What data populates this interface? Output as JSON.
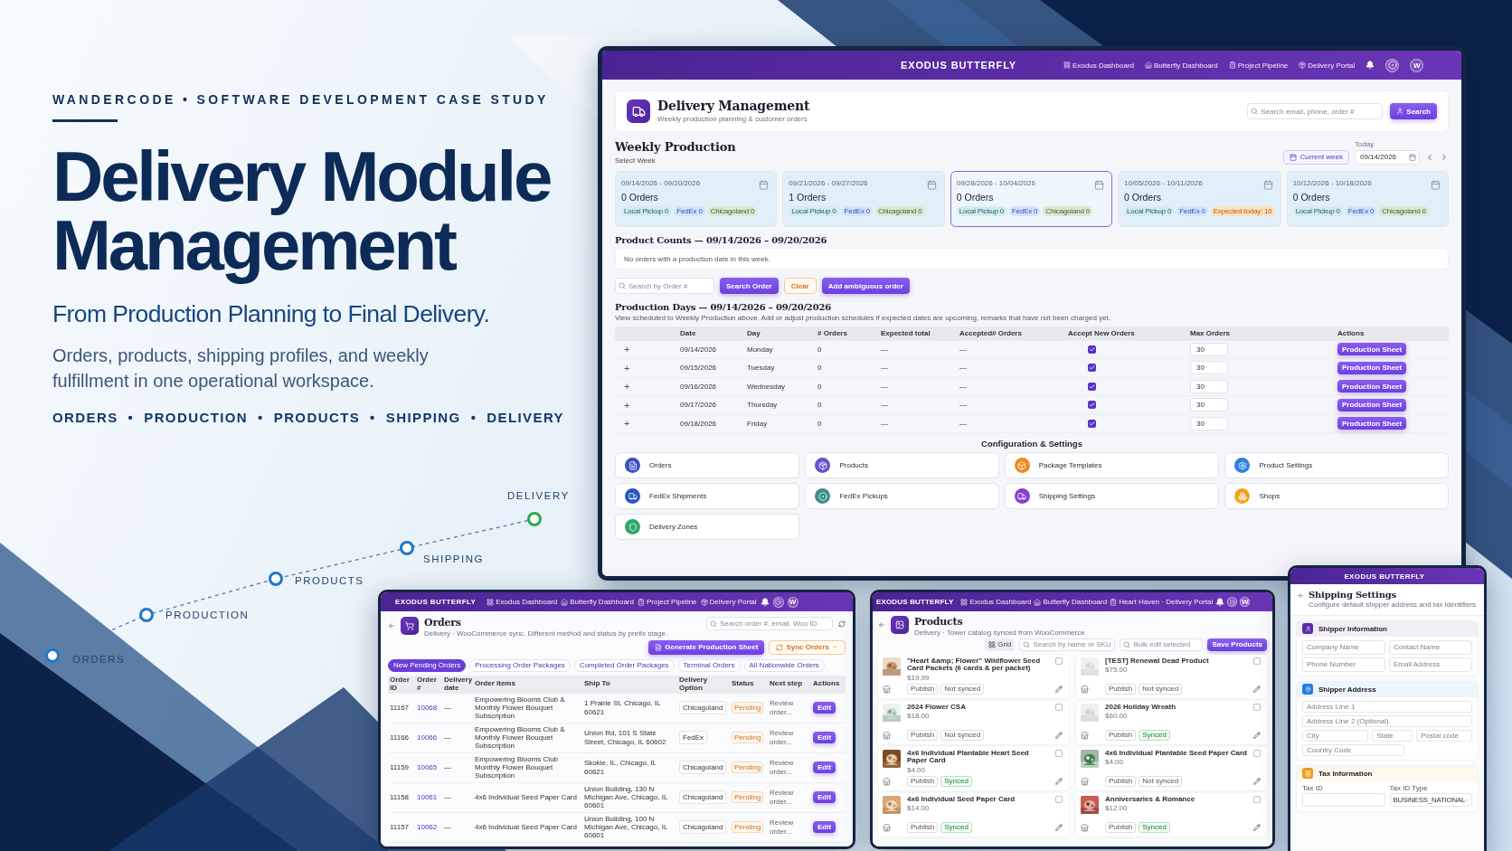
{
  "poster": {
    "kicker": "WANDERCODE • SOFTWARE DEVELOPMENT CASE STUDY",
    "headline_lines": [
      "Delivery Module",
      "Management"
    ],
    "subtitle": "From Production Planning to Final Delivery.",
    "description": "Orders, products, shipping profiles, and weekly fulfillment in one operational workspace.",
    "topic_separator": "•",
    "topics": [
      "ORDERS",
      "PRODUCTION",
      "PRODUCTS",
      "SHIPPING",
      "DELIVERY"
    ],
    "journey": [
      {
        "label": "ORDERS",
        "color": "#1f78c8"
      },
      {
        "label": "PRODUCTION",
        "color": "#1f78c8"
      },
      {
        "label": "PRODUCTS",
        "color": "#1f78c8"
      },
      {
        "label": "SHIPPING",
        "color": "#1f78c8"
      },
      {
        "label": "DELIVERY",
        "color": "#2ea84f"
      }
    ]
  },
  "main_app": {
    "bar": {
      "brand": "EXODUS BUTTERFLY",
      "nav": [
        "Exodus Dashboard",
        "Butterfly Dashboard",
        "Project Pipeline",
        "Delivery Portal"
      ],
      "avatar": "W"
    },
    "header": {
      "title": "Delivery Management",
      "subtitle": "Weekly production planning & customer orders",
      "search_placeholder": "Search email, phone, order #",
      "search_button": "Search"
    },
    "weekly": {
      "title": "Weekly Production",
      "hint": "Select Week",
      "current_week": "Current week",
      "today_label": "Today",
      "today_value": "09/14/2026",
      "weeks": [
        {
          "range": "09/14/2026 - 09/20/2026",
          "orders": "0 Orders",
          "selected": false,
          "chips": [
            {
              "label": "Local Pickup 0",
              "kind": "pickup"
            },
            {
              "label": "FedEx 0",
              "kind": "fedex"
            },
            {
              "label": "Chicagoland 0",
              "kind": "region"
            }
          ]
        },
        {
          "range": "09/21/2026 - 09/27/2026",
          "orders": "1 Orders",
          "selected": false,
          "chips": [
            {
              "label": "Local Pickup 0",
              "kind": "pickup"
            },
            {
              "label": "FedEx 0",
              "kind": "fedex"
            },
            {
              "label": "Chicagoland 0",
              "kind": "region"
            }
          ]
        },
        {
          "range": "09/28/2026 - 10/04/2026",
          "orders": "0 Orders",
          "selected": true,
          "chips": [
            {
              "label": "Local Pickup 0",
              "kind": "pickup"
            },
            {
              "label": "FedEx 0",
              "kind": "fedex"
            },
            {
              "label": "Chicagoland 0",
              "kind": "region"
            }
          ]
        },
        {
          "range": "10/05/2026 - 10/11/2026",
          "orders": "0 Orders",
          "selected": false,
          "chips": [
            {
              "label": "Local Pickup 0",
              "kind": "pickup"
            },
            {
              "label": "FedEx 0",
              "kind": "fedex"
            },
            {
              "label": "Expected today: 10",
              "kind": "alert"
            }
          ]
        },
        {
          "range": "10/12/2026 - 10/18/2026",
          "orders": "0 Orders",
          "selected": false,
          "chips": [
            {
              "label": "Local Pickup 0",
              "kind": "pickup"
            },
            {
              "label": "FedEx 0",
              "kind": "fedex"
            },
            {
              "label": "Chicagoland 0",
              "kind": "region"
            }
          ]
        }
      ]
    },
    "product_counts": {
      "title": "Product Counts — 09/14/2026 – 09/20/2026",
      "empty": "No orders with a production date in this week."
    },
    "order_search": {
      "placeholder": "Search by Order #",
      "search": "Search Order",
      "clear": "Clear",
      "add": "Add ambiguous order"
    },
    "production_days": {
      "title": "Production Days — 09/14/2026 – 09/20/2026",
      "note": "View scheduled to Weekly Production above. Add or adjust production schedules if expected dates are upcoming, remarks that have not been charged yet.",
      "columns": [
        "Date",
        "Day",
        "# Orders",
        "Expected total",
        "Accepted# Orders",
        "Accept New Orders",
        "Max Orders",
        "Actions"
      ],
      "rows": [
        {
          "expand": "+",
          "date": "09/14/2026",
          "day": "Monday",
          "orders": "0",
          "expected": "—",
          "accepted": "—",
          "accept_new": true,
          "max": "30",
          "action": "Production Sheet"
        },
        {
          "expand": "+",
          "date": "09/15/2026",
          "day": "Tuesday",
          "orders": "0",
          "expected": "—",
          "accepted": "—",
          "accept_new": true,
          "max": "30",
          "action": "Production Sheet"
        },
        {
          "expand": "+",
          "date": "09/16/2026",
          "day": "Wednesday",
          "orders": "0",
          "expected": "—",
          "accepted": "—",
          "accept_new": true,
          "max": "30",
          "action": "Production Sheet"
        },
        {
          "expand": "+",
          "date": "09/17/2026",
          "day": "Thursday",
          "orders": "0",
          "expected": "—",
          "accepted": "—",
          "accept_new": true,
          "max": "30",
          "action": "Production Sheet"
        },
        {
          "expand": "+",
          "date": "09/18/2026",
          "day": "Friday",
          "orders": "0",
          "expected": "—",
          "accepted": "—",
          "accept_new": true,
          "max": "30",
          "action": "Production Sheet"
        }
      ]
    },
    "config": {
      "title": "Configuration & Settings",
      "items": [
        {
          "label": "Orders",
          "color": "#3b4fc4"
        },
        {
          "label": "Products",
          "color": "#6a4fd0"
        },
        {
          "label": "Package Templates",
          "color": "#f08a1c"
        },
        {
          "label": "Product Settings",
          "color": "#2f7fe0"
        },
        {
          "label": "FedEx Shipments",
          "color": "#2b55c0"
        },
        {
          "label": "FedEx Pickups",
          "color": "#3a8f8a"
        },
        {
          "label": "Shipping Settings",
          "color": "#8a3fd0"
        },
        {
          "label": "Shops",
          "color": "#f2a21c"
        },
        {
          "label": "Delivery Zones",
          "color": "#2ea86a"
        }
      ]
    }
  },
  "orders_app": {
    "bar": {
      "brand": "EXODUS BUTTERFLY",
      "nav": [
        "Exodus Dashboard",
        "Butterfly Dashboard",
        "Project Pipeline",
        "Delivery Portal"
      ],
      "avatar": "W"
    },
    "title": "Orders",
    "subtitle": "Delivery · WooCommerce sync. Different method and status by prefix stage.",
    "search_placeholder": "Search order #, email, Woo ID",
    "generate": "Generate Production Sheet",
    "sync": "Sync Orders",
    "tabs": [
      {
        "label": "New Pending Orders",
        "selected": true
      },
      {
        "label": "Processing Order Packages",
        "selected": false
      },
      {
        "label": "Completed Order Packages",
        "selected": false
      },
      {
        "label": "Terminal Orders",
        "selected": false
      },
      {
        "label": "All Nationwide Orders",
        "selected": false
      }
    ],
    "columns": [
      "Order ID",
      "Order #",
      "Delivery date",
      "Order items",
      "Ship To",
      "Delivery Option",
      "Status",
      "Next step",
      "Actions"
    ],
    "rows": [
      {
        "id": "11167",
        "number": "10068",
        "date": "—",
        "items": "Empowering Blooms Club & Monthly Flower Bouquet Subscription",
        "ship_to": "1 Prairie St, Chicago, IL 60621",
        "option": "Chicagoland",
        "status": "Pending",
        "next": "Review order...",
        "action": "Edit"
      },
      {
        "id": "11166",
        "number": "10066",
        "date": "—",
        "items": "Empowering Blooms Club & Monthly Flower Bouquet Subscription",
        "ship_to": "Union Rd, 101 S State Street, Chicago, IL 60602",
        "option": "FedEx",
        "status": "Pending",
        "next": "Review order...",
        "action": "Edit"
      },
      {
        "id": "11159",
        "number": "10065",
        "date": "—",
        "items": "Empowering Blooms Club Monthly Flower Bouquet Subscription",
        "ship_to": "Skokie, IL, Chicago, IL 60621",
        "option": "Chicagoland",
        "status": "Pending",
        "next": "Review order...",
        "action": "Edit"
      },
      {
        "id": "11158",
        "number": "10061",
        "date": "—",
        "items": "4x6 Individual Seed Paper Card",
        "ship_to": "Union Building, 130 N Michigan Ave, Chicago, IL 60601",
        "option": "Chicagoland",
        "status": "Pending",
        "next": "Review order...",
        "action": "Edit"
      },
      {
        "id": "11157",
        "number": "10062",
        "date": "—",
        "items": "4x6 Individual Seed Paper Card",
        "ship_to": "Union Building, 100 N Michigan Ave, Chicago, IL 60601",
        "option": "Chicagoland",
        "status": "Pending",
        "next": "Review order...",
        "action": "Edit"
      }
    ]
  },
  "products_app": {
    "bar": {
      "brand": "EXODUS BUTTERFLY",
      "nav": [
        "Exodus Dashboard",
        "Butterfly Dashboard",
        "Heart Haven · Delivery Portal"
      ],
      "avatar": "W"
    },
    "title": "Products",
    "subtitle": "Delivery · Tower catalog synced from WooCommerce",
    "view_toggle": "Grid",
    "search_placeholder": "Search by name or SKU",
    "bulk_placeholder": "Bulk edit selected",
    "save": "Save Products",
    "products": [
      {
        "name": "\"Heart &amp; Flower\" Wildflower Seed Card Packets (6 cards & per packet)",
        "price": "$19.99",
        "status_label": "Publish",
        "synced": false,
        "sync_label": "Not synced",
        "checked": false
      },
      {
        "name": "[TEST] Renewal Dead Product",
        "price": "$75.00",
        "status_label": "Publish",
        "synced": false,
        "sync_label": "Not synced",
        "checked": false
      },
      {
        "name": "2024 Flower CSA",
        "price": "$18.00",
        "status_label": "Publish",
        "synced": false,
        "sync_label": "Not synced",
        "checked": false
      },
      {
        "name": "2026 Holiday Wreath",
        "price": "$60.00",
        "status_label": "Publish",
        "synced": true,
        "sync_label": "Synced",
        "checked": false
      },
      {
        "name": "4x6 Individual Plantable Heart Seed Paper Card",
        "price": "$4.00",
        "status_label": "Publish",
        "synced": true,
        "sync_label": "Synced",
        "checked": false
      },
      {
        "name": "4x6 Individual Plantable Seed Paper Card",
        "price": "$4.00",
        "status_label": "Publish",
        "synced": false,
        "sync_label": "Not synced",
        "checked": false
      },
      {
        "name": "4x6 Individual Seed Paper Card",
        "price": "$14.00",
        "status_label": "Publish",
        "synced": true,
        "sync_label": "Synced",
        "checked": false
      },
      {
        "name": "Anniversaries & Romance",
        "price": "$12.00",
        "status_label": "Publish",
        "synced": true,
        "sync_label": "Synced",
        "checked": false
      }
    ]
  },
  "shipping_app": {
    "bar": {
      "brand": "EXODUS BUTTERFLY"
    },
    "title": "Shipping Settings",
    "subtitle": "Configure default shipper address and tax identifiers",
    "sections": [
      {
        "title": "Shipper Information",
        "color": "#5a2aa8",
        "kind": "grid",
        "rows": [
          [
            {
              "placeholder": "Company Name"
            },
            {
              "placeholder": "Contact Name"
            }
          ],
          [
            {
              "placeholder": "Phone Number"
            },
            {
              "placeholder": "Email Address"
            }
          ]
        ]
      },
      {
        "title": "Shipper Address",
        "color": "#1f7fe0",
        "kind": "grid",
        "rows": [
          [
            {
              "placeholder": "Address Line 1"
            }
          ],
          [
            {
              "placeholder": "Address Line 2 (Optional)"
            }
          ],
          [
            {
              "placeholder": "City"
            },
            {
              "placeholder": "State"
            },
            {
              "placeholder": "Postal code"
            }
          ],
          [
            {
              "placeholder": "Country Code"
            }
          ]
        ]
      },
      {
        "title": "Tax Information",
        "color": "#f29a1c",
        "kind": "labeled",
        "fields": [
          {
            "label": "Tax ID",
            "kind": "text"
          },
          {
            "label": "Tax ID Type",
            "kind": "select",
            "value": "BUSINESS_NATIONAL"
          }
        ]
      }
    ]
  }
}
